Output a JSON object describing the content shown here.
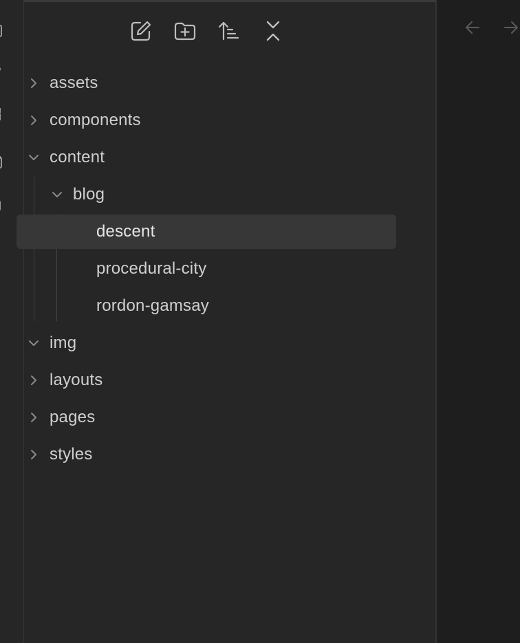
{
  "ribbon": {
    "icons": [
      "files-icon",
      "link-icon",
      "grid-icon",
      "calendar-icon",
      "book-icon",
      "dash-icon"
    ]
  },
  "toolbar": {
    "new_note": "new-note",
    "new_folder": "new-folder",
    "sort": "sort",
    "collapse_all": "collapse-all"
  },
  "tree": {
    "items": [
      {
        "label": "assets",
        "state": "collapsed"
      },
      {
        "label": "components",
        "state": "collapsed"
      },
      {
        "label": "content",
        "state": "expanded"
      },
      {
        "label": "blog",
        "state": "expanded"
      },
      {
        "label": "descent",
        "state": "file-active"
      },
      {
        "label": "procedural-city",
        "state": "file"
      },
      {
        "label": "rordon-gamsay",
        "state": "file"
      },
      {
        "label": "img",
        "state": "expanded"
      },
      {
        "label": "layouts",
        "state": "collapsed"
      },
      {
        "label": "pages",
        "state": "collapsed"
      },
      {
        "label": "styles",
        "state": "collapsed"
      }
    ]
  },
  "colors": {
    "background": "#262626",
    "editor_background": "#1e1e1e",
    "active_row": "#373737",
    "text": "#cfcfcf",
    "icon": "#bdbdbd",
    "muted_icon": "#5a5a5a"
  }
}
